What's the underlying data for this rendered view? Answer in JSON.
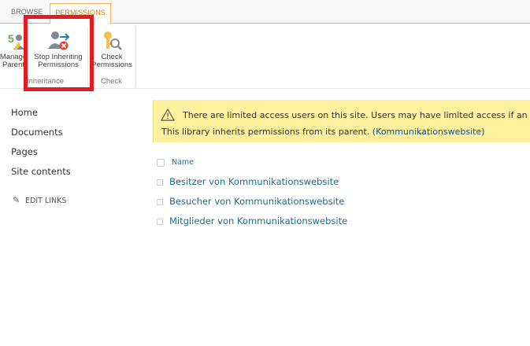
{
  "ribbon_tabs": {
    "browse": "BROWSE",
    "permissions": "PERMISSIONS"
  },
  "ribbon": {
    "manage_parent": {
      "line1": "Manage",
      "line2": "Parent"
    },
    "stop_inheriting": {
      "line1": "Stop Inheriting",
      "line2": "Permissions"
    },
    "check_permissions": {
      "line1": "Check",
      "line2": "Permissions"
    },
    "group_inheritance": "Inheritance",
    "group_check": "Check"
  },
  "leftnav": {
    "items": [
      "Home",
      "Documents",
      "Pages",
      "Site contents"
    ],
    "edit_links": "EDIT LINKS"
  },
  "banner": {
    "line1": "There are limited access users on this site. Users may have limited access if an item or",
    "line2_prefix": "This library inherits permissions from its parent. ",
    "line2_link": "(Kommunikationswebsite)"
  },
  "list": {
    "header": "Name",
    "rows": [
      "Besitzer von Kommunikationswebsite",
      "Besucher von Kommunikationswebsite",
      "Mitglieder von Kommunikationswebsite"
    ]
  },
  "colors": {
    "accent": "#f4b05a",
    "highlight": "#e31b23",
    "banner_bg": "#fff19d",
    "link": "#1f6a8b"
  },
  "icons": [
    "manage-parent-icon",
    "stop-inheriting-icon",
    "check-permissions-icon",
    "warning-icon",
    "pencil-icon"
  ]
}
